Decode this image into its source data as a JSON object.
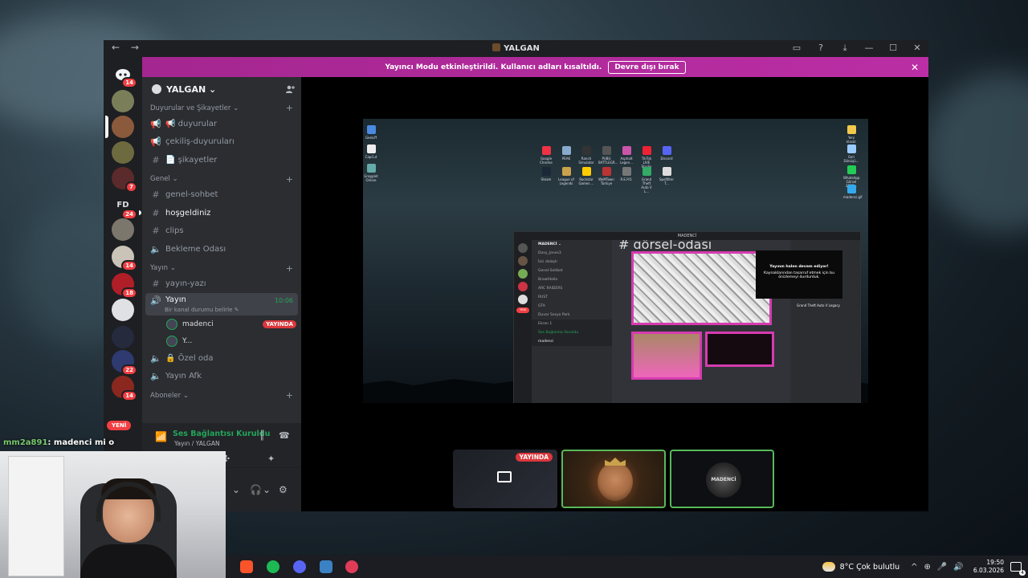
{
  "window": {
    "title": "YALGAN",
    "nav_back": "←",
    "nav_forward": "→",
    "controls": [
      "▭",
      "?",
      "⤓",
      "—",
      "☐",
      "✕"
    ]
  },
  "notice": {
    "text": "Yayıncı Modu etkinleştirildi. Kullanıcı adları kısaltıldı.",
    "button": "Devre dışı bırak",
    "close": "✕"
  },
  "rail": {
    "badges": [
      "14",
      "7",
      "24",
      "14",
      "18",
      "22",
      "14"
    ],
    "fd_label": "FD",
    "new_label": "YENİ"
  },
  "server": {
    "name": "YALGAN ⌄",
    "add_user_icon": "person-add-icon"
  },
  "categories": {
    "duyurular": "Duyurular ve Şikayetler ⌄",
    "genel": "Genel ⌄",
    "yayin": "Yayın ⌄",
    "aboneler": "Aboneler ⌄"
  },
  "channels": {
    "duyurular": "📢 duyurular",
    "cekilis": "çekiliş-duyuruları",
    "sikayetler": "📄 şikayetler",
    "genel_sohbet": "genel-sohbet",
    "hosgeldiniz": "hoşgeldiniz",
    "clips": "clips",
    "bekleme": "Bekleme Odası",
    "yayin_yazi": "yayın-yazı",
    "yayin_voice": "Yayın",
    "yayin_time": "10:06",
    "yayin_status": "Bir kanal durumu belirle ✎",
    "ozel_oda": "🔒 Özel oda",
    "yayin_afk": "Yayın Afk"
  },
  "voice_users": [
    {
      "name": "madenci",
      "badge": "YAYINDA"
    },
    {
      "name": "Y...",
      "badge": ""
    }
  ],
  "voice_panel": {
    "status": "Ses Bağlantısı Kuruldu",
    "sub": "Yayın / YALGAN"
  },
  "stream": {
    "live_label": "YAYINDA",
    "tile_logo": "MADENCİ",
    "inner_title": "MADENCİ",
    "inner_server": "MADENCİ ⌄",
    "inner_channel": "# görsel-odası",
    "inner_toast_title": "Yayının halen devam ediyor!",
    "inner_toast_body": "Kaynaklarından tasarruf etmek için bu önizlemeyi durdurduk.",
    "inner_user": "madenci",
    "inner_game": "Grand Theft Auto V Legacy",
    "inner_voice": "Ses Bağlantısı Kuruldu",
    "inner_screen": "Ekran 1",
    "inner_new": "YENİ",
    "inner_rows": [
      "Davy_Jones3",
      "İzci dolaştı",
      "Genel-Sohbet",
      "BrawlHalla",
      "ARC RAIDERS",
      "RUST",
      "GTA",
      "Duvar Sosyo Park"
    ],
    "desktop_icons": [
      "Google Chrome",
      "PEAK",
      "Ranch Simulator",
      "PUBG BATTLEGR...",
      "Asphalt Legen...",
      "TikTok LIVE Studio",
      "Discord",
      "Steam",
      "League of Legends",
      "Rockstar Games ...",
      "WeMTown Türkiye",
      "R.E.P.O.",
      "Grand Theft Auto V L...",
      "Spelfilter T...",
      "GeeLiff",
      "CapCut",
      "Grapplet Online",
      "Yeni klasör",
      "Geri Dönüşü...",
      "WhatsApp Görsel 2025...",
      "madenci.gif"
    ]
  },
  "chat_overlay": {
    "user": "mm2a891",
    "message": ": madenci mi o"
  },
  "taskbar": {
    "weather": "8°C  Çok bulutlu",
    "time": "19:50",
    "date": "6.03.2026",
    "notif_count": "4",
    "tray_icons": [
      "^",
      "⊕",
      "🎤",
      "🔊"
    ]
  }
}
